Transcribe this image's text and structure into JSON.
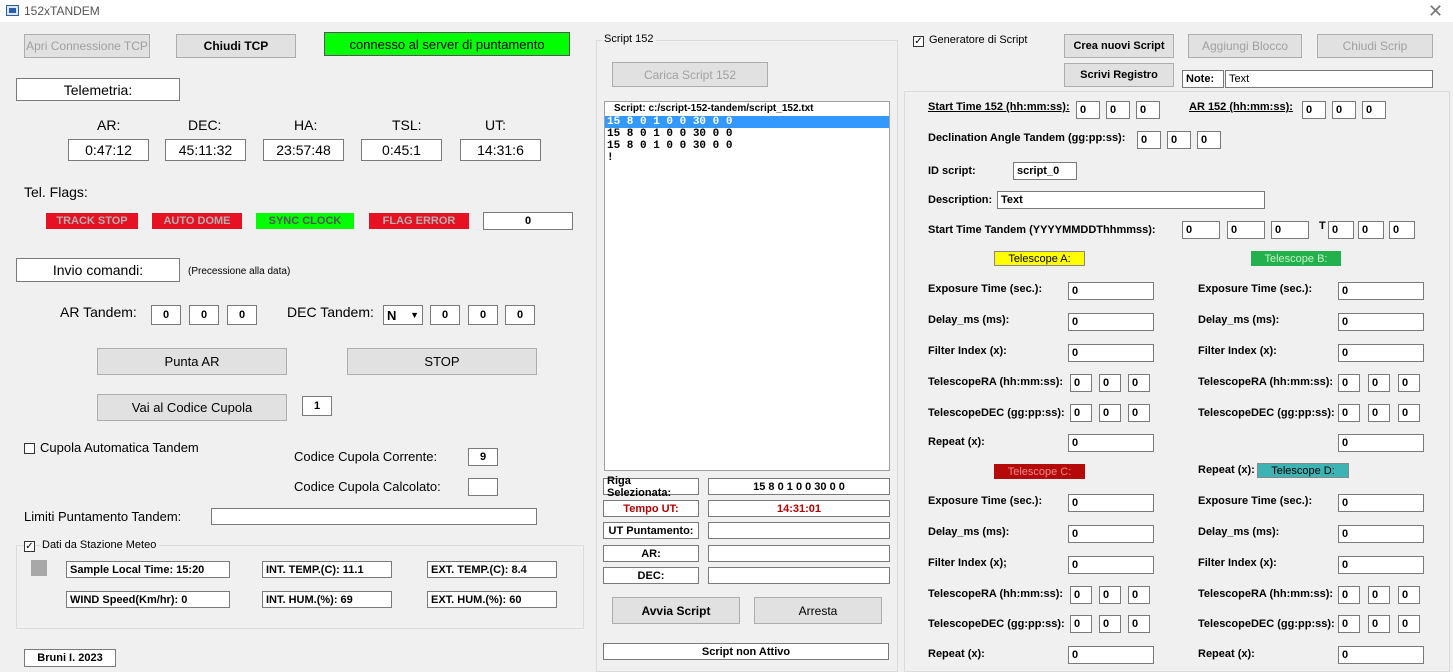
{
  "window": {
    "title": "152xTANDEM"
  },
  "left": {
    "open_tcp": "Apri Connessione TCP",
    "close_tcp": "Chiudi TCP",
    "status": "connesso al server di puntamento",
    "telemetry_title": "Telemetria:",
    "tel_labels": [
      "AR:",
      "DEC:",
      "HA:",
      "TSL:",
      "UT:"
    ],
    "tel_values": [
      "0:47:12",
      "45:11:32",
      "23:57:48",
      "0:45:1",
      "14:31:6"
    ],
    "flags_label": "Tel. Flags:",
    "flags": [
      "TRACK STOP",
      "AUTO DOME",
      "SYNC CLOCK",
      "FLAG ERROR"
    ],
    "flag_value": "0",
    "cmd_title": "Invio comandi:",
    "precession": "(Precessione alla data)",
    "ar_tandem_label": "AR Tandem:",
    "ar_tandem": [
      "0",
      "0",
      "0"
    ],
    "dec_tandem_label": "DEC Tandem:",
    "dec_sign": "N",
    "dec_tandem": [
      "0",
      "0",
      "0"
    ],
    "punta_ar": "Punta AR",
    "stop": "STOP",
    "vai_cupola": "Vai al Codice Cupola",
    "cupola_code": "1",
    "auto_cupola": "Cupola Automatica Tandem",
    "cod_corrente_label": "Codice Cupola Corrente:",
    "cod_corrente": "9",
    "cod_calcolato_label": "Codice Cupola Calcolato:",
    "cod_calcolato": "",
    "limiti_label": "Limiti Puntamento Tandem:",
    "limiti": "",
    "meteo_title": "Dati da Stazione Meteo",
    "meteo": [
      "Sample Local Time: 15:20",
      "INT. TEMP.(C):  11.1",
      "EXT. TEMP.(C):  8.4",
      "WIND Speed(Km/hr):  0",
      "INT. HUM.(%):  69",
      "EXT. HUM.(%):  60"
    ],
    "author": "Bruni I. 2023"
  },
  "middle": {
    "group_title": "Script 152",
    "load_btn": "Carica Script 152",
    "script_header": "Script:   c:/script-152-tandem/script_152.txt",
    "lines": [
      "15 8 0 1 0 0 30 0 0",
      "15 8 0 1 0 0 30 0 0",
      "15 8 0 1 0 0 30 0 0",
      "!"
    ],
    "riga_label": "Riga Selezionata:",
    "riga": "15 8 0 1 0 0 30 0 0",
    "tempo_label": "Tempo UT:",
    "tempo": "14:31:01",
    "ut_punt_label": "UT Puntamento:",
    "ut_punt": "",
    "ar_label": "AR:",
    "ar": "",
    "dec_label": "DEC:",
    "dec": "",
    "avvia": "Avvia Script",
    "arresta": "Arresta",
    "status": "Script non Attivo"
  },
  "right": {
    "gen_label": "Generatore di Script",
    "crea": "Crea nuovi Script",
    "aggiungi": "Aggiungi Blocco",
    "chiudi": "Chiudi Scrip",
    "scrivi": "Scrivi Registro",
    "note_label": "Note:",
    "note": "Text",
    "start152_label": "Start Time 152 (hh:mm:ss):",
    "start152": [
      "0",
      "0",
      "0"
    ],
    "ar152_label": "AR 152 (hh:mm:ss):",
    "ar152": [
      "0",
      "0",
      "0"
    ],
    "decl_label": "Declination Angle Tandem  (gg:pp:ss):",
    "decl": [
      "0",
      "0",
      "0"
    ],
    "id_label": "ID script:",
    "id": "script_0",
    "desc_label": "Description:",
    "desc": "Text",
    "start_tandem_label": "Start Time Tandem (YYYYMMDDThhmmss):",
    "start_tandem": [
      "0",
      "0",
      "0",
      "0",
      "0",
      "0"
    ],
    "t_sep": "T",
    "tel_a": "Telescope A:",
    "tel_b": "Telescope B:",
    "tel_c": "Telescope C:",
    "tel_d": "Telescope D:",
    "repeat_d_prefix": "Repeat (x):",
    "colors": {
      "a": "#ffff00",
      "b": "#22b14c",
      "c": "#b40a0a",
      "d": "#3cb4b4"
    },
    "labels": {
      "exposure": "Exposure Time (sec.):",
      "delay": "Delay_ms (ms):",
      "filter": "Filter Index (x):",
      "filter_c": "Filter Index (x);",
      "ra": "TelescopeRA (hh:mm:ss):",
      "dec": "TelescopeDEC (gg:pp:ss):",
      "repeat": "Repeat (x):"
    },
    "zero": "0"
  }
}
